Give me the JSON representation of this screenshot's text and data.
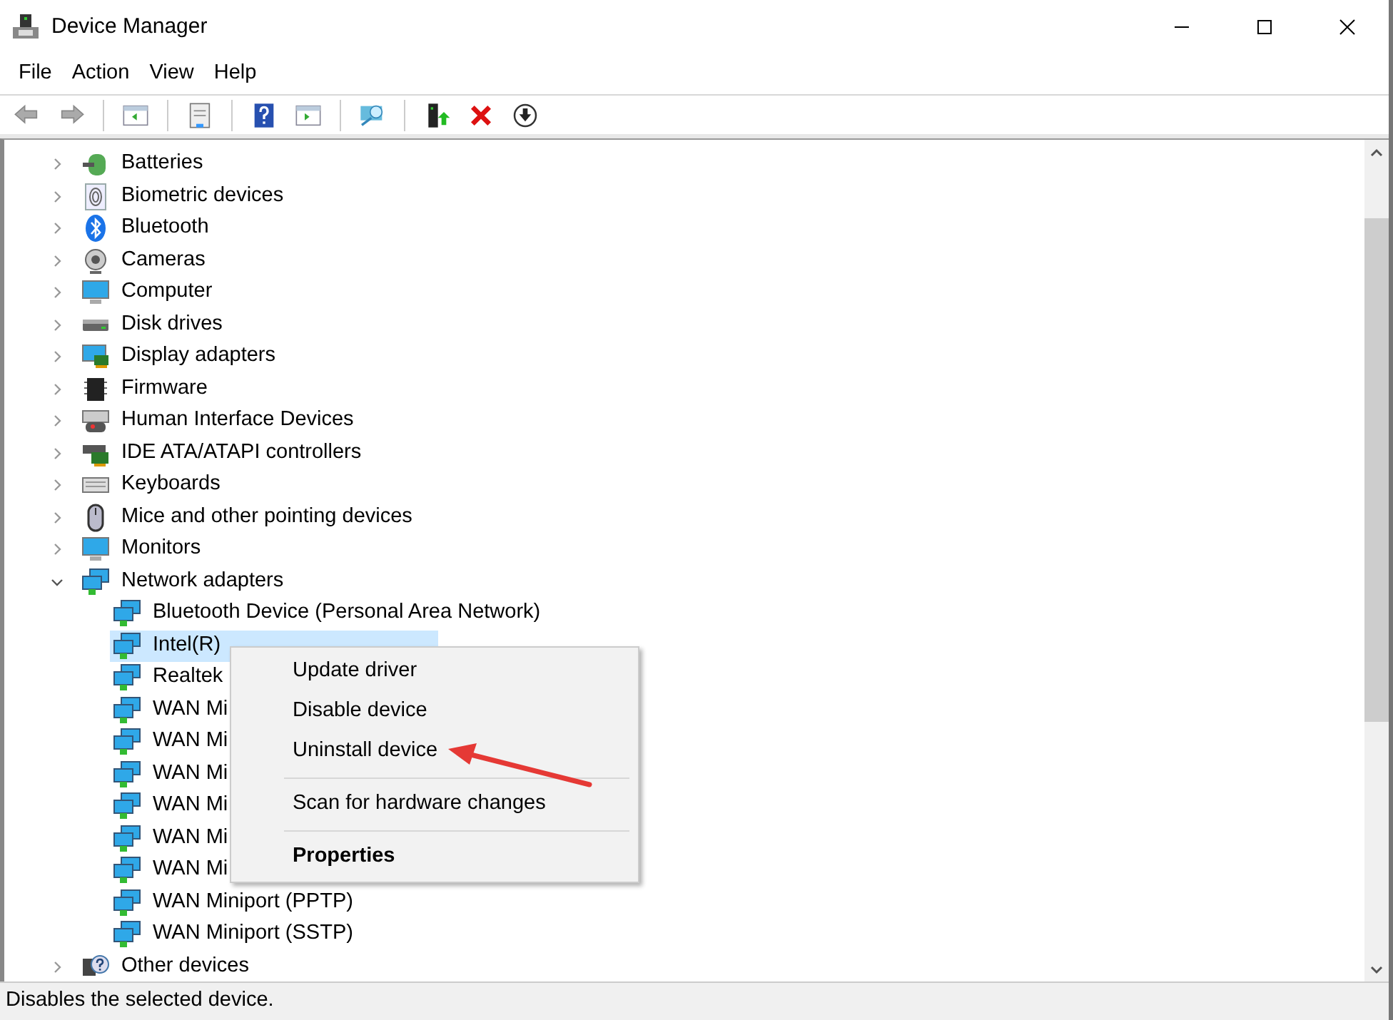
{
  "window": {
    "title": "Device Manager"
  },
  "menu": [
    "File",
    "Action",
    "View",
    "Help"
  ],
  "tree": [
    {
      "label": "Batteries",
      "expanded": false,
      "selected": false
    },
    {
      "label": "Biometric devices",
      "expanded": false,
      "selected": false
    },
    {
      "label": "Bluetooth",
      "expanded": false,
      "selected": false
    },
    {
      "label": "Cameras",
      "expanded": false,
      "selected": false
    },
    {
      "label": "Computer",
      "expanded": false,
      "selected": false
    },
    {
      "label": "Disk drives",
      "expanded": false,
      "selected": false
    },
    {
      "label": "Display adapters",
      "expanded": false,
      "selected": false
    },
    {
      "label": "Firmware",
      "expanded": false,
      "selected": false
    },
    {
      "label": "Human Interface Devices",
      "expanded": false,
      "selected": false
    },
    {
      "label": "IDE ATA/ATAPI controllers",
      "expanded": false,
      "selected": false
    },
    {
      "label": "Keyboards",
      "expanded": false,
      "selected": false
    },
    {
      "label": "Mice and other pointing devices",
      "expanded": false,
      "selected": false
    },
    {
      "label": "Monitors",
      "expanded": false,
      "selected": false
    },
    {
      "label": "Network adapters",
      "expanded": true,
      "selected": false,
      "children": [
        {
          "label": "Bluetooth Device (Personal Area Network)",
          "selected": false
        },
        {
          "label": "Intel(R)",
          "selected": true
        },
        {
          "label": "Realtek",
          "selected": false
        },
        {
          "label": "WAN Mi",
          "selected": false
        },
        {
          "label": "WAN Mi",
          "selected": false
        },
        {
          "label": "WAN Mi",
          "selected": false
        },
        {
          "label": "WAN Mi",
          "selected": false
        },
        {
          "label": "WAN Mi",
          "selected": false
        },
        {
          "label": "WAN Mi",
          "selected": false
        },
        {
          "label": "WAN Miniport (PPTP)",
          "selected": false
        },
        {
          "label": "WAN Miniport (SSTP)",
          "selected": false
        }
      ]
    },
    {
      "label": "Other devices",
      "expanded": false,
      "selected": false
    }
  ],
  "context_menu": [
    {
      "kind": "item",
      "label": "Update driver",
      "default": false
    },
    {
      "kind": "item",
      "label": "Disable device",
      "default": false
    },
    {
      "kind": "item",
      "label": "Uninstall device",
      "default": false
    },
    {
      "kind": "separator"
    },
    {
      "kind": "item",
      "label": "Scan for hardware changes",
      "default": false
    },
    {
      "kind": "separator"
    },
    {
      "kind": "item",
      "label": "Properties",
      "default": true
    }
  ],
  "status_bar": "Disables the selected device."
}
